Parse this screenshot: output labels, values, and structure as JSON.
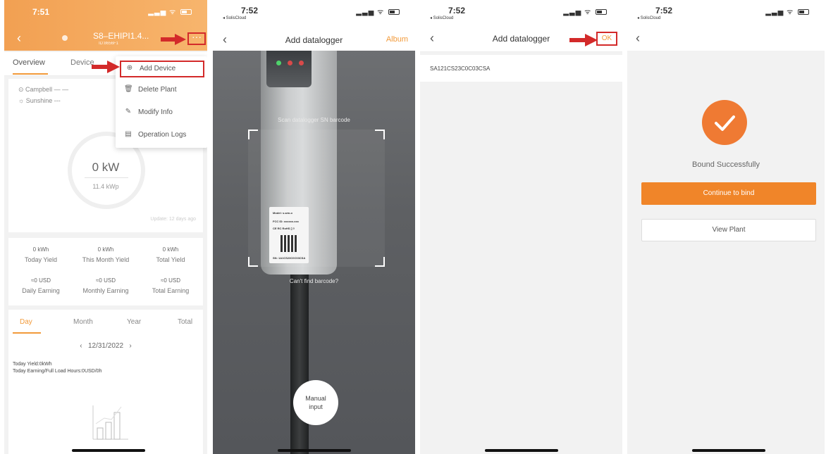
{
  "panel1": {
    "time": "7:51",
    "plant_title": "S8–EHIPI1.4...",
    "plant_id": "ID:8656F1",
    "more_label": "···",
    "tabs": [
      "Overview",
      "Device"
    ],
    "menu": [
      {
        "label": "Add Device",
        "icon": "plus-circle-icon"
      },
      {
        "label": "Delete Plant",
        "icon": "trash-icon"
      },
      {
        "label": "Modify Info",
        "icon": "edit-icon"
      },
      {
        "label": "Operation Logs",
        "icon": "log-icon"
      }
    ],
    "locations": [
      "Campbell — —",
      "Sunshine ---"
    ],
    "power": "0 kW",
    "capacity": "11.4 kWp",
    "updated": "Update: 12 days ago",
    "stats": [
      {
        "value": "0 kWh",
        "label": "Today Yield"
      },
      {
        "value": "0 kWh",
        "label": "This Month Yield"
      },
      {
        "value": "0 kWh",
        "label": "Total Yield"
      },
      {
        "value": "≈0 USD",
        "label": "Daily Earning"
      },
      {
        "value": "≈0 USD",
        "label": "Monthly Earning"
      },
      {
        "value": "≈0 USD",
        "label": "Total Earning"
      }
    ],
    "period_tabs": [
      "Day",
      "Month",
      "Year",
      "Total"
    ],
    "date": "12/31/2022",
    "note1": "Today Yield:0kWh",
    "note2": "Today Earning/Full Load Hours:0USD/0h"
  },
  "panel2": {
    "time": "7:52",
    "back_app": "◂ SolisCloud",
    "title": "Add datalogger",
    "album": "Album",
    "scan_text": "Scan datalogger SN barcode",
    "cant_find": "Can't find barcode?",
    "manual_1": "Manual",
    "manual_2": "input",
    "sticker_1": "Model: s-wm-o",
    "sticker_2": "FCC ID: xxxxxx.xxx",
    "sticker_3": "CE RC RoHS ▯ ◊",
    "sticker_4": "SN: 1A1CS23C0C03CSA"
  },
  "panel3": {
    "time": "7:52",
    "back_app": "◂ SolisCloud",
    "title": "Add datalogger",
    "ok": "OK",
    "sn": "SA121CS23C0C03CSA"
  },
  "panel4": {
    "time": "7:52",
    "back_app": "◂ SolisCloud",
    "success": "Bound Successfully",
    "continue": "Continue to bind",
    "view_plant": "View Plant"
  },
  "colors": {
    "accent": "#f29a3a",
    "highlight": "#d32a2a",
    "success": "#ef7a33"
  }
}
